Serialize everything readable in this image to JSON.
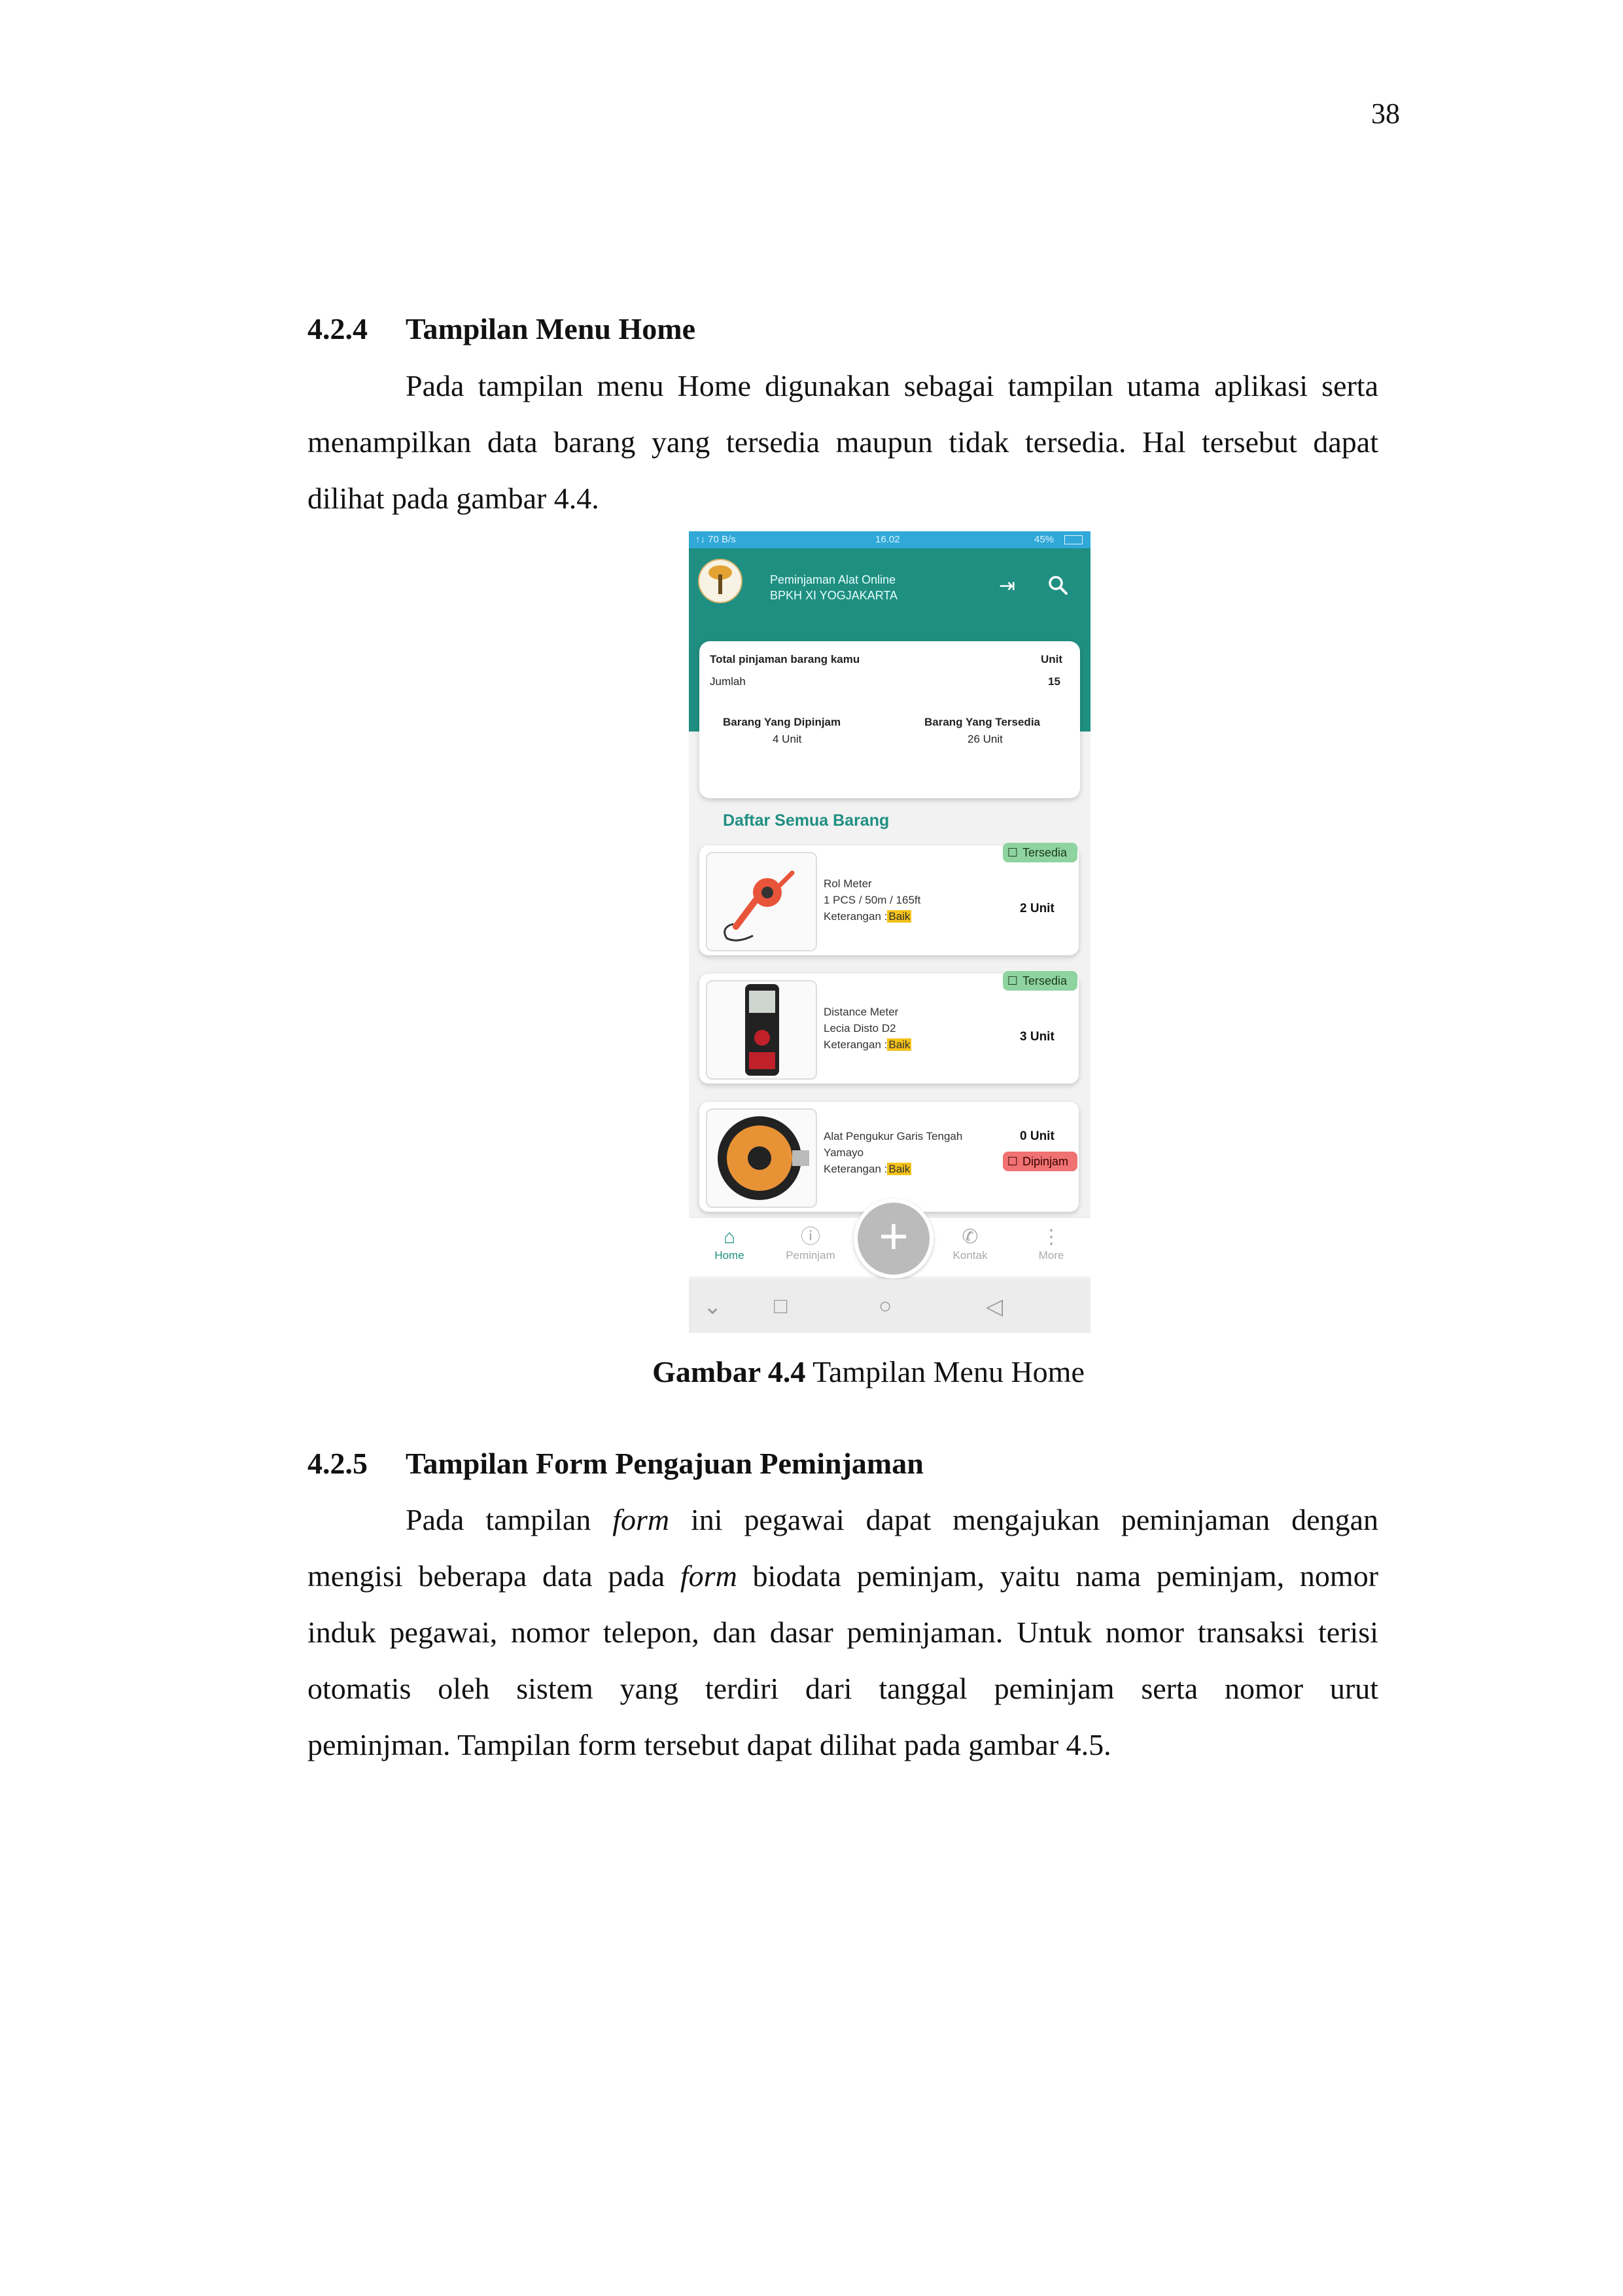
{
  "page_number": "38",
  "section_424": {
    "number": "4.2.4",
    "title": "Tampilan Menu Home",
    "lines": [
      "Pada tampilan menu Home digunakan sebagai tampilan utama aplikasi serta",
      "menampilkan data barang yang tersedia maupun tidak tersedia. Hal tersebut dapat",
      "dilihat pada gambar 4.4."
    ]
  },
  "figure": {
    "caption_label": "Gambar 4.4",
    "caption_text": "Tampilan Menu Home"
  },
  "phone": {
    "status": {
      "left": "↑↓ 70 B/s",
      "time": "16.02",
      "right": "45%"
    },
    "app_title": "Peminjaman Alat Online",
    "app_subtitle": "BPKH XI YOGJAKARTA",
    "summary": {
      "total_label": "Total pinjaman barang kamu",
      "unit_label": "Unit",
      "jumlah_label": "Jumlah",
      "jumlah_value": "15",
      "dipinjam_label": "Barang Yang Dipinjam",
      "dipinjam_value": "4 Unit",
      "tersedia_label": "Barang Yang Tersedia",
      "tersedia_value": "26 Unit"
    },
    "list_title": "Daftar Semua Barang",
    "keterangan_label": "Keterangan :",
    "items": [
      {
        "name": "Rol Meter",
        "spec": "1 PCS / 50m / 165ft",
        "kondisi": "Baik",
        "qty": "2 Unit",
        "status": "Tersedia"
      },
      {
        "name": "Distance Meter",
        "spec": "Lecia Disto D2",
        "kondisi": "Baik",
        "qty": "3 Unit",
        "status": "Tersedia"
      },
      {
        "name": "Alat Pengukur Garis Tengah",
        "spec": "Yamayo",
        "kondisi": "Baik",
        "qty": "0 Unit",
        "status": "Dipinjam"
      }
    ],
    "nav": [
      "Home",
      "Peminjam",
      "Kontak",
      "More"
    ],
    "colors": {
      "primary": "#1f8f82",
      "status_bar": "#30a8d8",
      "available": "#8fd4a0",
      "borrowed": "#f07272",
      "highlight": "#f4c21a"
    }
  },
  "section_425": {
    "number": "4.2.5",
    "title": "Tampilan Form Pengajuan Peminjaman",
    "lines": [
      [
        "Pada tampilan ",
        "form",
        " ini pegawai dapat mengajukan peminjaman dengan"
      ],
      [
        "mengisi beberapa data pada ",
        "form",
        " biodata peminjam, yaitu nama peminjam, nomor"
      ],
      "induk pegawai, nomor telepon, dan dasar peminjaman. Untuk nomor transaksi terisi",
      "otomatis oleh sistem yang terdiri dari tanggal peminjam serta nomor urut",
      "peminjman. Tampilan form tersebut dapat dilihat pada gambar 4.5."
    ]
  }
}
